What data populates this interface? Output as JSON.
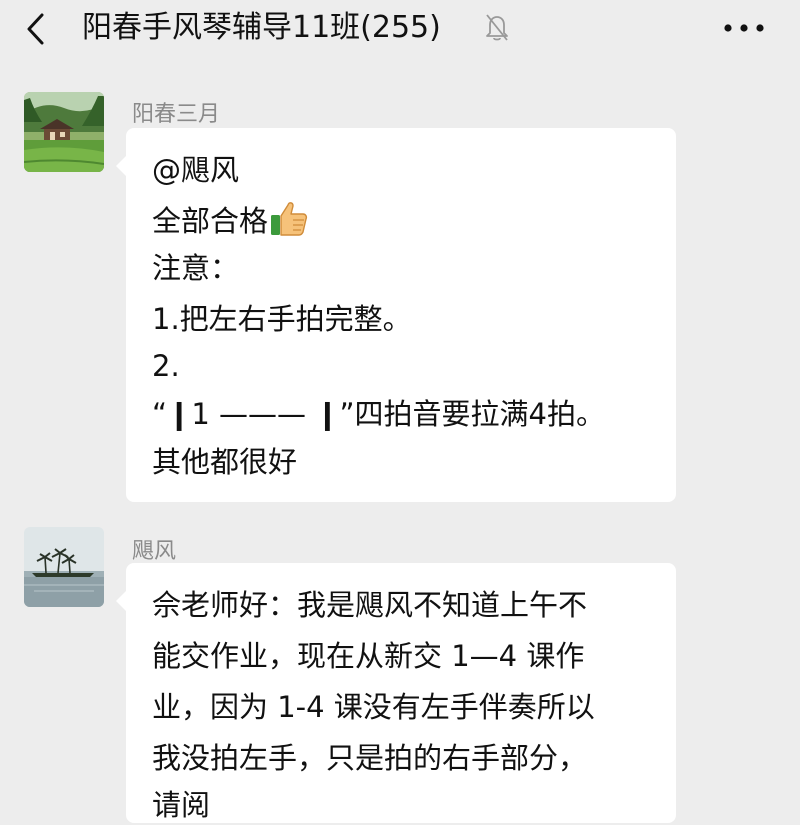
{
  "header": {
    "title": "阳春手风琴辅导11班(255)"
  },
  "icons": {
    "back": "chevron-left-icon",
    "mute": "bell-muted-icon",
    "more": "more-dots-icon",
    "thumbs_up": "thumbs-up-emoji"
  },
  "messages": [
    {
      "sender": "阳春三月",
      "lines": [
        "@飓风",
        "全部合格",
        "注意：",
        "1.把左右手拍完整。",
        "2.",
        "“❙1 ——— ❙”四拍音要拉满4拍。",
        "其他都很好"
      ]
    },
    {
      "sender": "飓风",
      "lines": [
        "佘老师好：我是飓风不知道上午不",
        "能交作业，现在从新交 1—4 课作",
        "业，因为 1-4 课没有左手伴奏所以",
        "我没拍左手，只是拍的右手部分，",
        "请阅"
      ]
    }
  ],
  "colors": {
    "background": "#ededed",
    "bubble": "#ffffff",
    "sender_name": "#8a8a8a",
    "text": "#111111"
  }
}
